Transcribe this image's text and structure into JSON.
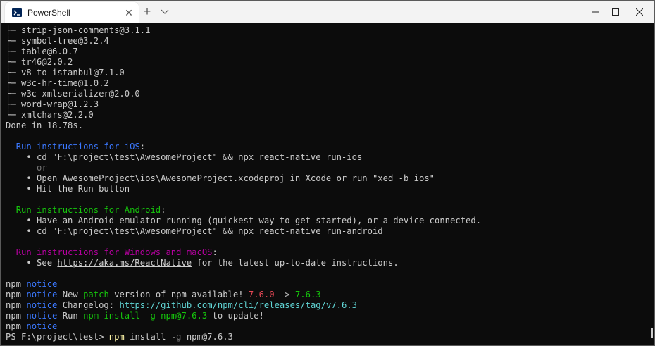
{
  "window": {
    "tab_title": "PowerShell",
    "close_tab_glyph": "✕",
    "new_tab_glyph": "+",
    "icons": [
      "powershell-icon",
      "close-icon",
      "plus-icon",
      "chevron-down-icon",
      "minimize-icon",
      "maximize-icon",
      "close-window-icon"
    ]
  },
  "terminal": {
    "tree": [
      "├─ strip-json-comments@3.1.1",
      "├─ symbol-tree@3.2.4",
      "├─ table@6.0.7",
      "├─ tr46@2.0.2",
      "├─ v8-to-istanbul@7.1.0",
      "├─ w3c-hr-time@1.0.2",
      "├─ w3c-xmlserializer@2.0.0",
      "├─ word-wrap@1.2.3",
      "└─ xmlchars@2.2.0"
    ],
    "done": "Done in 18.78s.",
    "ios": {
      "heading": "Run instructions for iOS",
      "colon": ":",
      "line1": "    • cd \"F:\\project\\test\\AwesomeProject\" && npx react-native run-ios",
      "or": "    - or -",
      "line2": "    • Open AwesomeProject\\ios\\AwesomeProject.xcodeproj in Xcode or run \"xed -b ios\"",
      "line3": "    • Hit the Run button"
    },
    "android": {
      "heading": "Run instructions for Android",
      "colon": ":",
      "line1": "    • Have an Android emulator running (quickest way to get started), or a device connected.",
      "line2": "    • cd \"F:\\project\\test\\AwesomeProject\" && npx react-native run-android"
    },
    "windows": {
      "heading": "Run instructions for Windows and macOS",
      "colon": ":",
      "prefix": "    • See ",
      "link": "https://aka.ms/ReactNative",
      "suffix": " for the latest up-to-date instructions."
    },
    "npm": {
      "label": "npm",
      "notice": "notice",
      "new_prefix": "New ",
      "patch": "patch",
      "new_mid": " version of npm available! ",
      "old_version": "7.6.0",
      "arrow": " -> ",
      "new_version": "7.6.3",
      "changelog_prefix": "Changelog: ",
      "changelog_url": "https://github.com/npm/cli/releases/tag/v7.6.3",
      "run_prefix": "Run ",
      "run_cmd": "npm install -g npm@7.6.3",
      "run_suffix": " to update!"
    },
    "prompt": {
      "ps": "PS F:\\project\\test> ",
      "cmd": "npm",
      "args1": " install ",
      "flag": "-g",
      "args2": " npm@7.6.3"
    }
  },
  "colors": {
    "terminal_bg": "#0c0c0c",
    "text": "#cccccc",
    "blue": "#3b78ff",
    "green": "#16c60c",
    "magenta": "#b4009e",
    "red": "#e74856",
    "cyan": "#61d6d6",
    "yellow": "#f9f1a5"
  }
}
